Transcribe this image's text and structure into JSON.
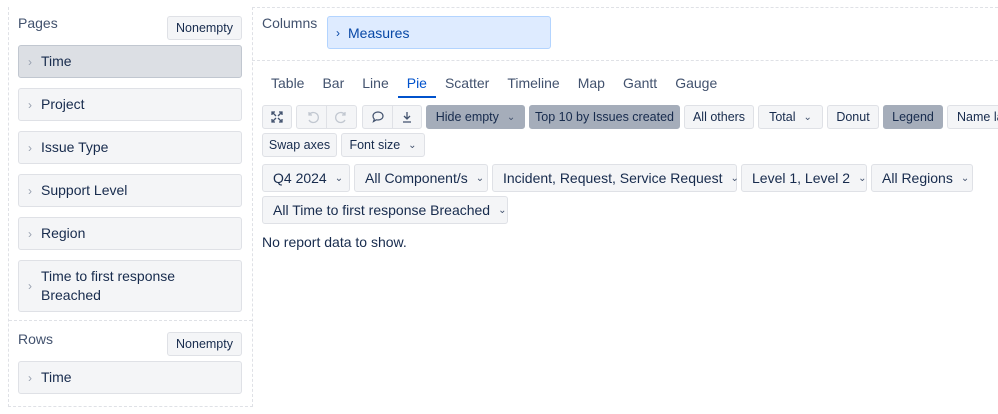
{
  "left": {
    "pages": {
      "title": "Pages",
      "nonempty_label": "Nonempty",
      "items": [
        {
          "label": "Time"
        },
        {
          "label": "Project"
        },
        {
          "label": "Issue Type"
        },
        {
          "label": "Support Level"
        },
        {
          "label": "Region"
        },
        {
          "label": "Time to first response Breached"
        }
      ]
    },
    "rows": {
      "title": "Rows",
      "nonempty_label": "Nonempty",
      "items": [
        {
          "label": "Time"
        }
      ]
    }
  },
  "columns": {
    "title": "Columns",
    "chip_label": "Measures"
  },
  "tabs": [
    "Table",
    "Bar",
    "Line",
    "Pie",
    "Scatter",
    "Timeline",
    "Map",
    "Gantt",
    "Gauge"
  ],
  "selected_tab": "Pie",
  "toolbar": {
    "hide_empty": "Hide empty",
    "top10": "Top 10 by Issues created",
    "all_others": "All others",
    "total": "Total",
    "donut": "Donut",
    "legend": "Legend",
    "name_label_partial": "Name la",
    "swap_axes": "Swap axes",
    "font_size": "Font size"
  },
  "filters": [
    "Q4 2024",
    "All Component/s",
    "Incident, Request, Service Request",
    "Level 1, Level 2",
    "All Regions",
    "All Time to first response Breached"
  ],
  "message": "No report data to show.",
  "icons": {
    "chevron": "›",
    "caret": "⌄"
  }
}
